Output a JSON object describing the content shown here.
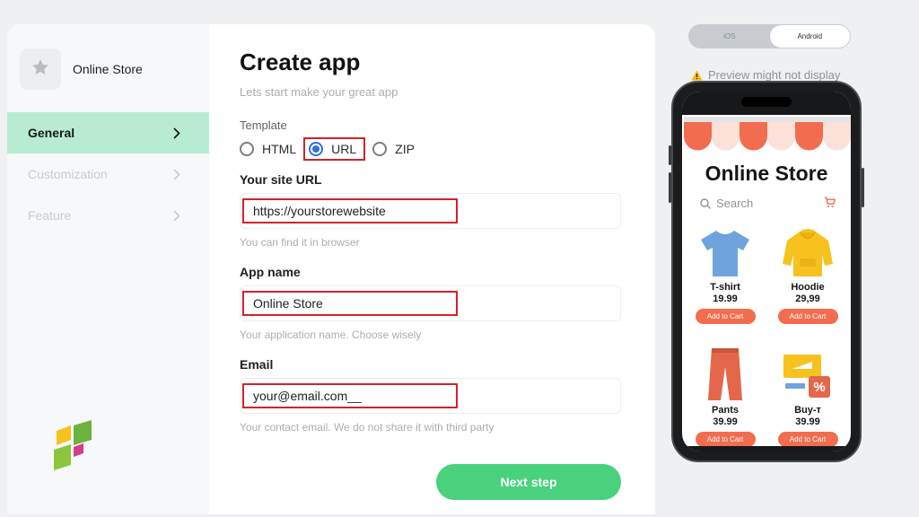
{
  "sidebar": {
    "brand_name": "Online Store",
    "items": [
      {
        "label": "General",
        "active": true
      },
      {
        "label": "Customization",
        "active": false
      },
      {
        "label": "Feature",
        "active": false
      }
    ]
  },
  "form": {
    "title": "Create app",
    "subtitle": "Lets start make your great app",
    "template_label": "Template",
    "template_options": [
      "HTML",
      "URL",
      "ZIP"
    ],
    "template_selected": "URL",
    "site_url_label": "Your site URL",
    "site_url_value": "https://yourstorewebsite",
    "site_url_hint": "You can find it in browser",
    "app_name_label": "App name",
    "app_name_value": "Online Store",
    "app_name_hint": "Your application name. Choose wisely",
    "email_label": "Email",
    "email_value": "your@email.com__",
    "email_hint": "Your contact email. We do not share it with third party",
    "next_label": "Next step"
  },
  "preview": {
    "platforms": [
      "iOS",
      "Android"
    ],
    "selected_platform": "Android",
    "note": "Preview might not display",
    "store_title": "Online Store",
    "search_placeholder": "Search",
    "products": [
      {
        "name": "T-shirt",
        "price": "19.99",
        "button": "Add to Cart"
      },
      {
        "name": "Hoodie",
        "price": "29,99",
        "button": "Add to Cart"
      },
      {
        "name": "Pants",
        "price": "39.99",
        "button": "Add to Cart"
      },
      {
        "name": "Buy-т",
        "price": "39.99",
        "button": "Add to Cart"
      }
    ]
  },
  "colors": {
    "accent_green": "#49d17e",
    "nav_active_bg": "#b8ecd2",
    "highlight_red": "#d2232a",
    "radio_blue": "#2f6fe0",
    "cart_orange": "#f26d4f"
  },
  "icons": [
    "star-icon",
    "chevron-right-icon",
    "warning-icon",
    "search-icon",
    "cart-icon",
    "app-logo-icon"
  ]
}
